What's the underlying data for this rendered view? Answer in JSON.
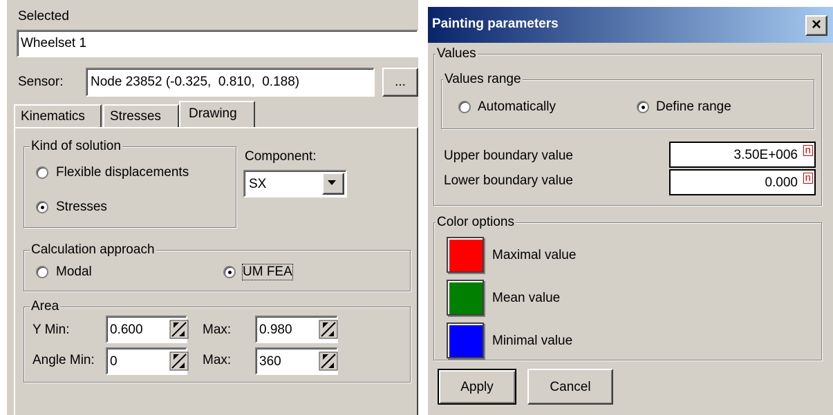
{
  "left": {
    "selected_label": "Selected",
    "selected_value": "Wheelset 1",
    "sensor_label": "Sensor:",
    "sensor_value": "Node 23852 (-0.325,  0.810,  0.188)",
    "sensor_button": "...",
    "tabs": [
      {
        "label": "Kinematics"
      },
      {
        "label": "Stresses"
      },
      {
        "label": "Drawing"
      }
    ],
    "kind_group": {
      "title": "Kind of solution",
      "options": [
        {
          "label": "Flexible displacements",
          "checked": false
        },
        {
          "label": "Stresses",
          "checked": true
        }
      ]
    },
    "component_label": "Component:",
    "component_value": "SX",
    "approach_group": {
      "title": "Calculation approach",
      "options": [
        {
          "label": "Modal",
          "checked": false
        },
        {
          "label": "UM FEA",
          "checked": true
        }
      ]
    },
    "area_group": {
      "title": "Area",
      "y_min_label": "Y Min:",
      "y_min_value": "0.600",
      "y_max_label": "Max:",
      "y_max_value": "0.980",
      "angle_min_label": "Angle Min:",
      "angle_min_value": "0",
      "angle_max_label": "Max:",
      "angle_max_value": "360"
    }
  },
  "right": {
    "title": "Painting parameters",
    "close_glyph": "×",
    "values_group": {
      "title": "Values",
      "range_group": {
        "title": "Values range",
        "options": [
          {
            "label": "Automatically",
            "checked": false
          },
          {
            "label": "Define range",
            "checked": true
          }
        ]
      },
      "upper_label": "Upper boundary value",
      "upper_value": "3.50E+006",
      "lower_label": "Lower boundary value",
      "lower_value": "0.000",
      "field_icon": "n"
    },
    "color_group": {
      "title": "Color options",
      "items": [
        {
          "label": "Maximal value",
          "color": "#ff0000"
        },
        {
          "label": "Mean value",
          "color": "#007f00"
        },
        {
          "label": "Minimal value",
          "color": "#0000ff"
        }
      ]
    },
    "apply_label": "Apply",
    "cancel_label": "Cancel"
  },
  "icons": {
    "spin": "spin-updown-icon",
    "dropdown": "chevron-down-icon",
    "close": "close-icon",
    "function": "function-n-icon"
  }
}
